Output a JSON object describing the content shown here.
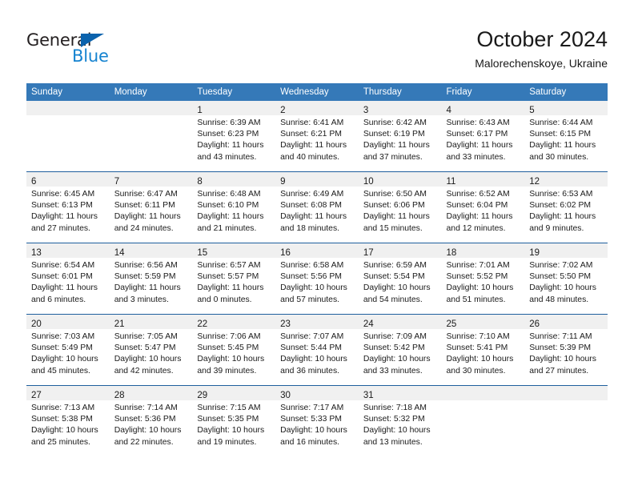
{
  "brand": {
    "name_part1": "General",
    "name_part2": "Blue",
    "triangle_color": "#0b63ad",
    "blue_color": "#1583d0"
  },
  "header": {
    "month_title": "October 2024",
    "location": "Malorechenskoye, Ukraine"
  },
  "theme": {
    "header_bg": "#3579b8",
    "row_separator": "#1f5f9e",
    "day_band_bg": "#f0f0f0",
    "text": "#1a1a1a"
  },
  "weekdays": [
    "Sunday",
    "Monday",
    "Tuesday",
    "Wednesday",
    "Thursday",
    "Friday",
    "Saturday"
  ],
  "weeks": [
    [
      {
        "day": "",
        "sunrise": "",
        "sunset": "",
        "daylight_a": "",
        "daylight_b": ""
      },
      {
        "day": "",
        "sunrise": "",
        "sunset": "",
        "daylight_a": "",
        "daylight_b": ""
      },
      {
        "day": "1",
        "sunrise": "Sunrise: 6:39 AM",
        "sunset": "Sunset: 6:23 PM",
        "daylight_a": "Daylight: 11 hours",
        "daylight_b": "and 43 minutes."
      },
      {
        "day": "2",
        "sunrise": "Sunrise: 6:41 AM",
        "sunset": "Sunset: 6:21 PM",
        "daylight_a": "Daylight: 11 hours",
        "daylight_b": "and 40 minutes."
      },
      {
        "day": "3",
        "sunrise": "Sunrise: 6:42 AM",
        "sunset": "Sunset: 6:19 PM",
        "daylight_a": "Daylight: 11 hours",
        "daylight_b": "and 37 minutes."
      },
      {
        "day": "4",
        "sunrise": "Sunrise: 6:43 AM",
        "sunset": "Sunset: 6:17 PM",
        "daylight_a": "Daylight: 11 hours",
        "daylight_b": "and 33 minutes."
      },
      {
        "day": "5",
        "sunrise": "Sunrise: 6:44 AM",
        "sunset": "Sunset: 6:15 PM",
        "daylight_a": "Daylight: 11 hours",
        "daylight_b": "and 30 minutes."
      }
    ],
    [
      {
        "day": "6",
        "sunrise": "Sunrise: 6:45 AM",
        "sunset": "Sunset: 6:13 PM",
        "daylight_a": "Daylight: 11 hours",
        "daylight_b": "and 27 minutes."
      },
      {
        "day": "7",
        "sunrise": "Sunrise: 6:47 AM",
        "sunset": "Sunset: 6:11 PM",
        "daylight_a": "Daylight: 11 hours",
        "daylight_b": "and 24 minutes."
      },
      {
        "day": "8",
        "sunrise": "Sunrise: 6:48 AM",
        "sunset": "Sunset: 6:10 PM",
        "daylight_a": "Daylight: 11 hours",
        "daylight_b": "and 21 minutes."
      },
      {
        "day": "9",
        "sunrise": "Sunrise: 6:49 AM",
        "sunset": "Sunset: 6:08 PM",
        "daylight_a": "Daylight: 11 hours",
        "daylight_b": "and 18 minutes."
      },
      {
        "day": "10",
        "sunrise": "Sunrise: 6:50 AM",
        "sunset": "Sunset: 6:06 PM",
        "daylight_a": "Daylight: 11 hours",
        "daylight_b": "and 15 minutes."
      },
      {
        "day": "11",
        "sunrise": "Sunrise: 6:52 AM",
        "sunset": "Sunset: 6:04 PM",
        "daylight_a": "Daylight: 11 hours",
        "daylight_b": "and 12 minutes."
      },
      {
        "day": "12",
        "sunrise": "Sunrise: 6:53 AM",
        "sunset": "Sunset: 6:02 PM",
        "daylight_a": "Daylight: 11 hours",
        "daylight_b": "and 9 minutes."
      }
    ],
    [
      {
        "day": "13",
        "sunrise": "Sunrise: 6:54 AM",
        "sunset": "Sunset: 6:01 PM",
        "daylight_a": "Daylight: 11 hours",
        "daylight_b": "and 6 minutes."
      },
      {
        "day": "14",
        "sunrise": "Sunrise: 6:56 AM",
        "sunset": "Sunset: 5:59 PM",
        "daylight_a": "Daylight: 11 hours",
        "daylight_b": "and 3 minutes."
      },
      {
        "day": "15",
        "sunrise": "Sunrise: 6:57 AM",
        "sunset": "Sunset: 5:57 PM",
        "daylight_a": "Daylight: 11 hours",
        "daylight_b": "and 0 minutes."
      },
      {
        "day": "16",
        "sunrise": "Sunrise: 6:58 AM",
        "sunset": "Sunset: 5:56 PM",
        "daylight_a": "Daylight: 10 hours",
        "daylight_b": "and 57 minutes."
      },
      {
        "day": "17",
        "sunrise": "Sunrise: 6:59 AM",
        "sunset": "Sunset: 5:54 PM",
        "daylight_a": "Daylight: 10 hours",
        "daylight_b": "and 54 minutes."
      },
      {
        "day": "18",
        "sunrise": "Sunrise: 7:01 AM",
        "sunset": "Sunset: 5:52 PM",
        "daylight_a": "Daylight: 10 hours",
        "daylight_b": "and 51 minutes."
      },
      {
        "day": "19",
        "sunrise": "Sunrise: 7:02 AM",
        "sunset": "Sunset: 5:50 PM",
        "daylight_a": "Daylight: 10 hours",
        "daylight_b": "and 48 minutes."
      }
    ],
    [
      {
        "day": "20",
        "sunrise": "Sunrise: 7:03 AM",
        "sunset": "Sunset: 5:49 PM",
        "daylight_a": "Daylight: 10 hours",
        "daylight_b": "and 45 minutes."
      },
      {
        "day": "21",
        "sunrise": "Sunrise: 7:05 AM",
        "sunset": "Sunset: 5:47 PM",
        "daylight_a": "Daylight: 10 hours",
        "daylight_b": "and 42 minutes."
      },
      {
        "day": "22",
        "sunrise": "Sunrise: 7:06 AM",
        "sunset": "Sunset: 5:45 PM",
        "daylight_a": "Daylight: 10 hours",
        "daylight_b": "and 39 minutes."
      },
      {
        "day": "23",
        "sunrise": "Sunrise: 7:07 AM",
        "sunset": "Sunset: 5:44 PM",
        "daylight_a": "Daylight: 10 hours",
        "daylight_b": "and 36 minutes."
      },
      {
        "day": "24",
        "sunrise": "Sunrise: 7:09 AM",
        "sunset": "Sunset: 5:42 PM",
        "daylight_a": "Daylight: 10 hours",
        "daylight_b": "and 33 minutes."
      },
      {
        "day": "25",
        "sunrise": "Sunrise: 7:10 AM",
        "sunset": "Sunset: 5:41 PM",
        "daylight_a": "Daylight: 10 hours",
        "daylight_b": "and 30 minutes."
      },
      {
        "day": "26",
        "sunrise": "Sunrise: 7:11 AM",
        "sunset": "Sunset: 5:39 PM",
        "daylight_a": "Daylight: 10 hours",
        "daylight_b": "and 27 minutes."
      }
    ],
    [
      {
        "day": "27",
        "sunrise": "Sunrise: 7:13 AM",
        "sunset": "Sunset: 5:38 PM",
        "daylight_a": "Daylight: 10 hours",
        "daylight_b": "and 25 minutes."
      },
      {
        "day": "28",
        "sunrise": "Sunrise: 7:14 AM",
        "sunset": "Sunset: 5:36 PM",
        "daylight_a": "Daylight: 10 hours",
        "daylight_b": "and 22 minutes."
      },
      {
        "day": "29",
        "sunrise": "Sunrise: 7:15 AM",
        "sunset": "Sunset: 5:35 PM",
        "daylight_a": "Daylight: 10 hours",
        "daylight_b": "and 19 minutes."
      },
      {
        "day": "30",
        "sunrise": "Sunrise: 7:17 AM",
        "sunset": "Sunset: 5:33 PM",
        "daylight_a": "Daylight: 10 hours",
        "daylight_b": "and 16 minutes."
      },
      {
        "day": "31",
        "sunrise": "Sunrise: 7:18 AM",
        "sunset": "Sunset: 5:32 PM",
        "daylight_a": "Daylight: 10 hours",
        "daylight_b": "and 13 minutes."
      },
      {
        "day": "",
        "sunrise": "",
        "sunset": "",
        "daylight_a": "",
        "daylight_b": ""
      },
      {
        "day": "",
        "sunrise": "",
        "sunset": "",
        "daylight_a": "",
        "daylight_b": ""
      }
    ]
  ]
}
